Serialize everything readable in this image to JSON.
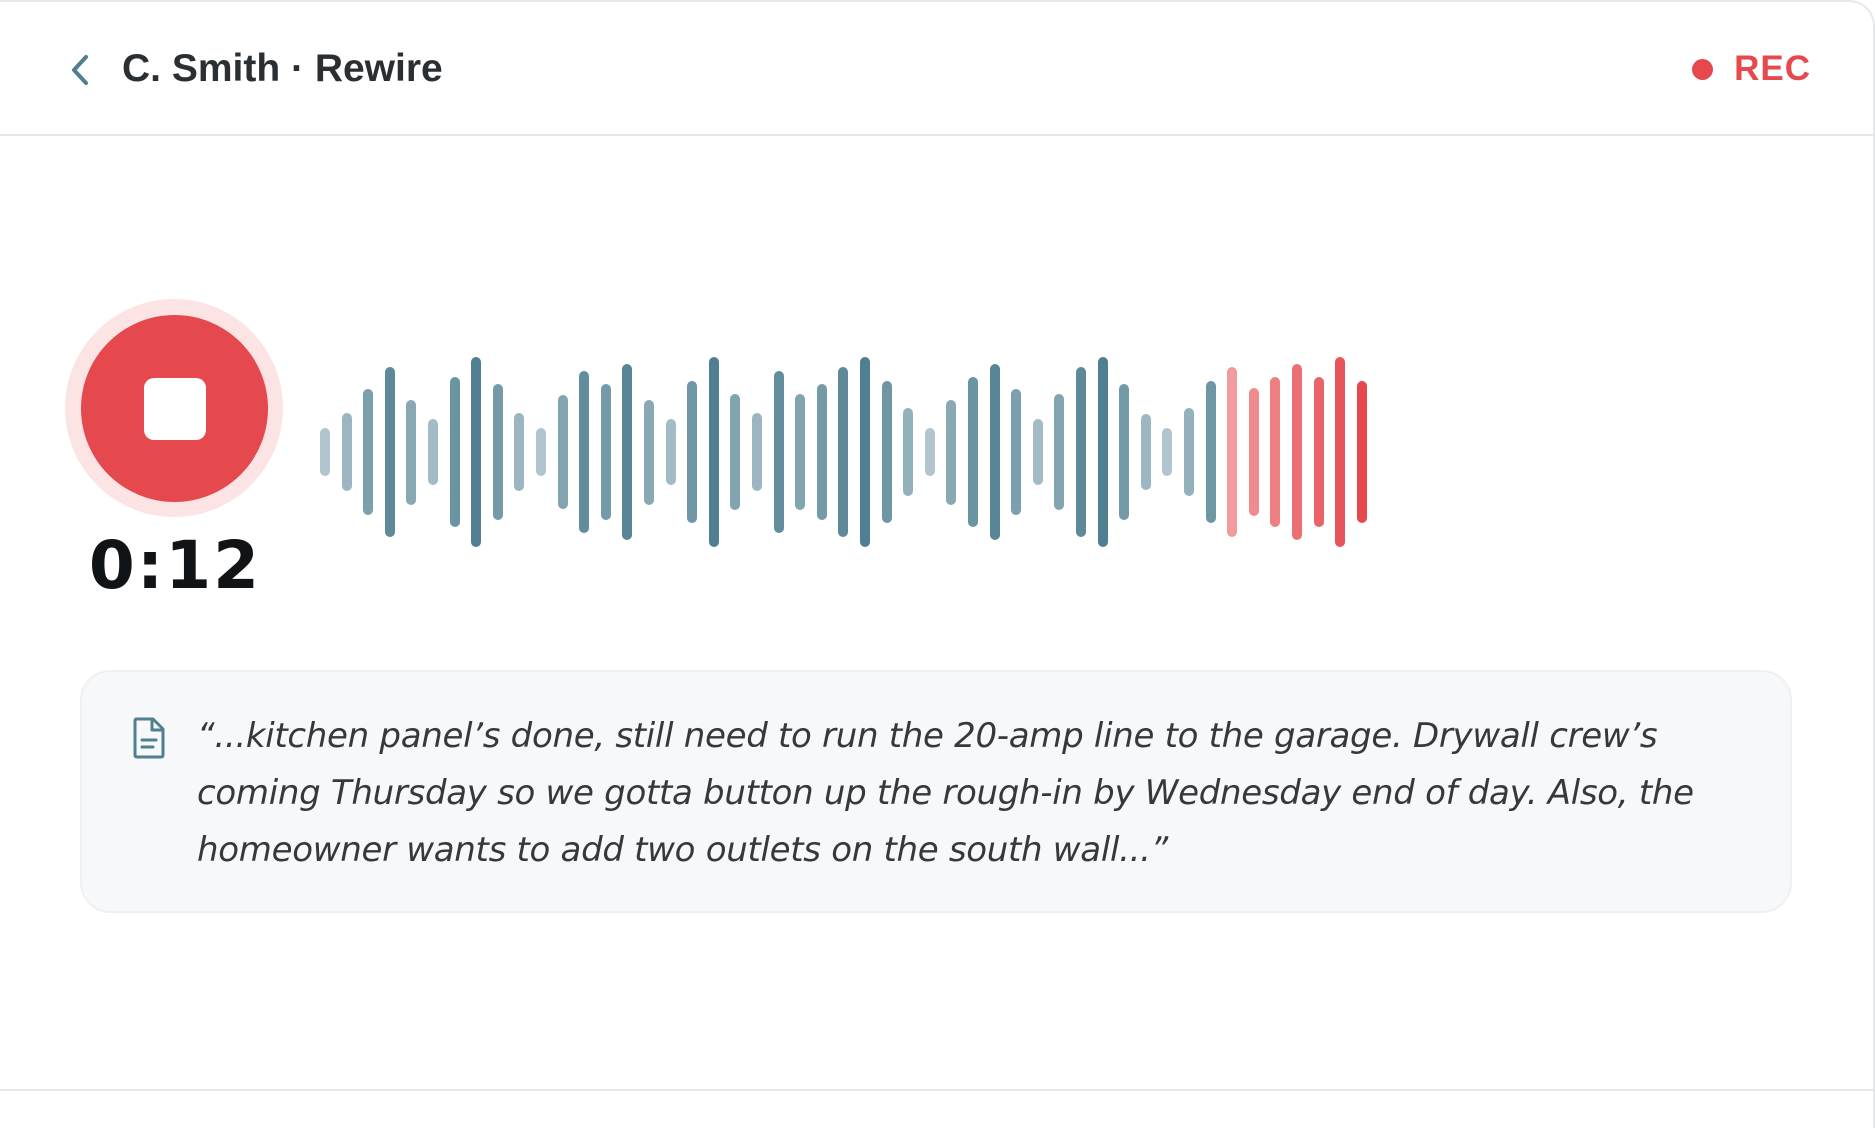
{
  "header": {
    "title": "C. Smith · Rewire",
    "back_icon": "chevron-left-icon",
    "recording_label": "REC",
    "recording_color": "#e5484d"
  },
  "recorder": {
    "state": "recording",
    "stop_icon": "stop-icon",
    "elapsed": "0:12",
    "button_color": "#e5484d"
  },
  "waveform": {
    "level_scale": "relative 0–1",
    "levels": [
      0.16,
      0.34,
      0.62,
      0.88,
      0.5,
      0.27,
      0.76,
      1.0,
      0.68,
      0.34,
      0.16,
      0.55,
      0.83,
      0.68,
      0.92,
      0.5,
      0.27,
      0.72,
      1.0,
      0.56,
      0.34,
      0.83,
      0.56,
      0.68,
      0.88,
      1.0,
      0.72,
      0.4,
      0.16,
      0.5,
      0.76,
      0.92,
      0.62,
      0.27,
      0.56,
      0.88,
      1.0,
      0.68,
      0.33,
      0.16,
      0.4,
      0.72,
      0.88,
      0.63,
      0.76,
      0.92,
      0.76,
      1.0,
      0.72
    ],
    "played_color": "#4f7f90",
    "live_color": "#e5484d"
  },
  "transcript": {
    "icon": "document-icon",
    "text": "“...kitchen panel’s done, still need to run the 20-amp line to the garage. Drywall crew’s coming Thursday so we gotta button up the rough-in by Wednesday end of day. Also, the homeowner wants to add two outlets on the south wall...”"
  }
}
